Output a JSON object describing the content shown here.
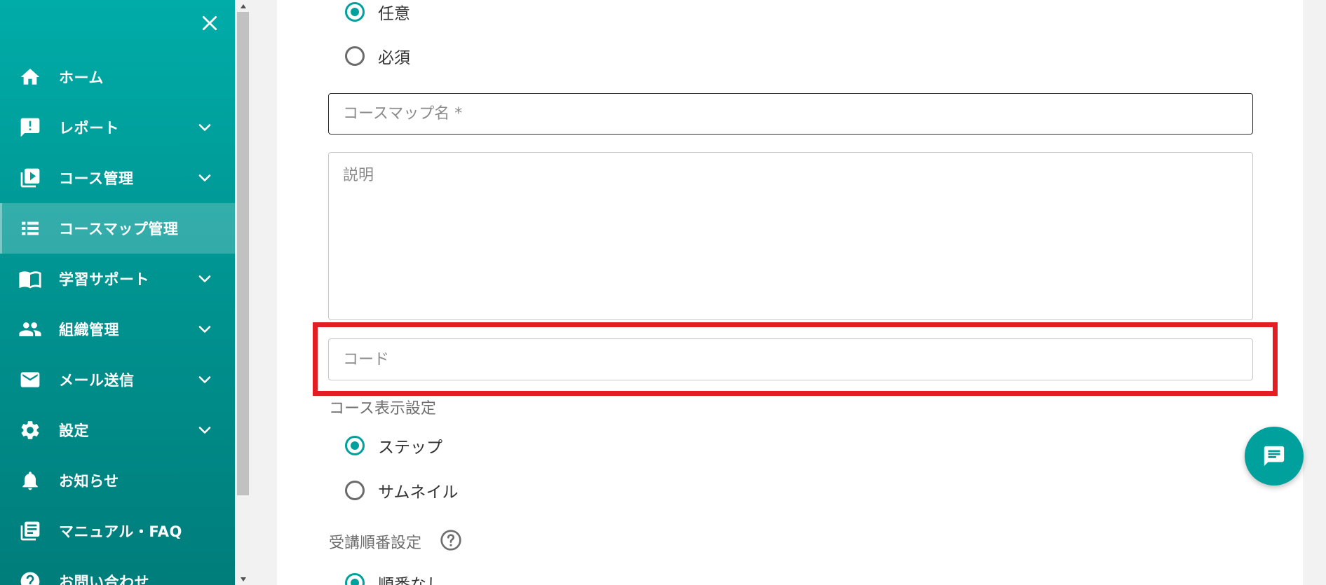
{
  "sidebar": {
    "items": [
      {
        "label": "ホーム",
        "icon": "home-icon",
        "expandable": false,
        "active": false
      },
      {
        "label": "レポート",
        "icon": "report-icon",
        "expandable": true,
        "active": false
      },
      {
        "label": "コース管理",
        "icon": "video-library-icon",
        "expandable": true,
        "active": false
      },
      {
        "label": "コースマップ管理",
        "icon": "list-icon",
        "expandable": false,
        "active": true
      },
      {
        "label": "学習サポート",
        "icon": "book-icon",
        "expandable": true,
        "active": false
      },
      {
        "label": "組織管理",
        "icon": "people-icon",
        "expandable": true,
        "active": false
      },
      {
        "label": "メール送信",
        "icon": "mail-icon",
        "expandable": true,
        "active": false
      },
      {
        "label": "設定",
        "icon": "gear-icon",
        "expandable": true,
        "active": false
      },
      {
        "label": "お知らせ",
        "icon": "bell-icon",
        "expandable": false,
        "active": false
      },
      {
        "label": "マニュアル・FAQ",
        "icon": "manual-icon",
        "expandable": false,
        "active": false
      },
      {
        "label": "お問い合わせ",
        "icon": "help-circle-icon",
        "expandable": false,
        "active": false
      }
    ]
  },
  "form": {
    "requirement": {
      "options": [
        {
          "label": "任意",
          "checked": true
        },
        {
          "label": "必須",
          "checked": false
        }
      ]
    },
    "coursemap_name": {
      "placeholder": "コースマップ名 *",
      "value": ""
    },
    "description": {
      "placeholder": "説明",
      "value": ""
    },
    "code": {
      "placeholder": "コード",
      "value": ""
    },
    "display_setting": {
      "label": "コース表示設定",
      "options": [
        {
          "label": "ステップ",
          "checked": true
        },
        {
          "label": "サムネイル",
          "checked": false
        }
      ]
    },
    "order_setting": {
      "label": "受講順番設定",
      "options": [
        {
          "label": "順番なし",
          "checked": true
        }
      ]
    }
  },
  "colors": {
    "accent": "#00a19c",
    "highlight": "#e41c23",
    "sidebar_top": "#00aca8",
    "sidebar_bottom": "#007d7b"
  }
}
